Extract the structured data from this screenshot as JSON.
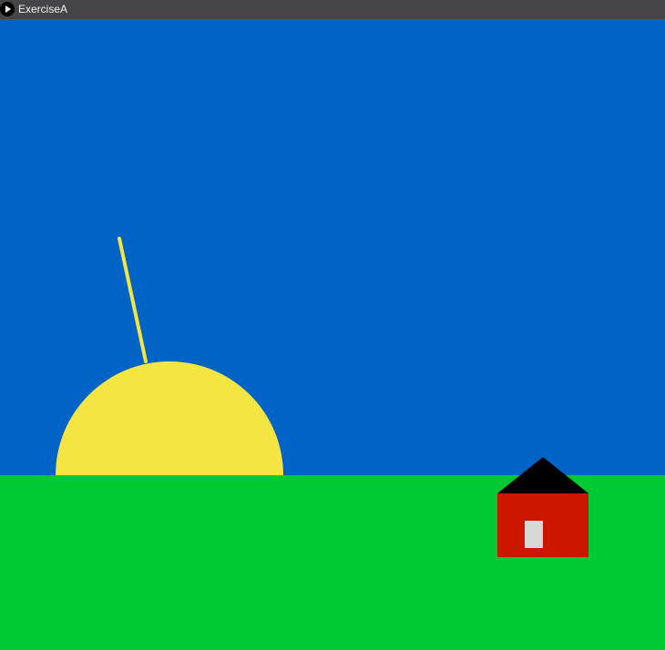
{
  "window": {
    "title": "ExerciseA",
    "icon": "play-app-icon"
  },
  "scene": {
    "sky_color": "#0063c6",
    "ground_color": "#00ca33",
    "sun_color": "#f4e542",
    "sun_ray_color": "#f4e542",
    "house_wall_color": "#cc1600",
    "house_roof_color": "#000000",
    "house_door_color": "#d8d8d8"
  }
}
